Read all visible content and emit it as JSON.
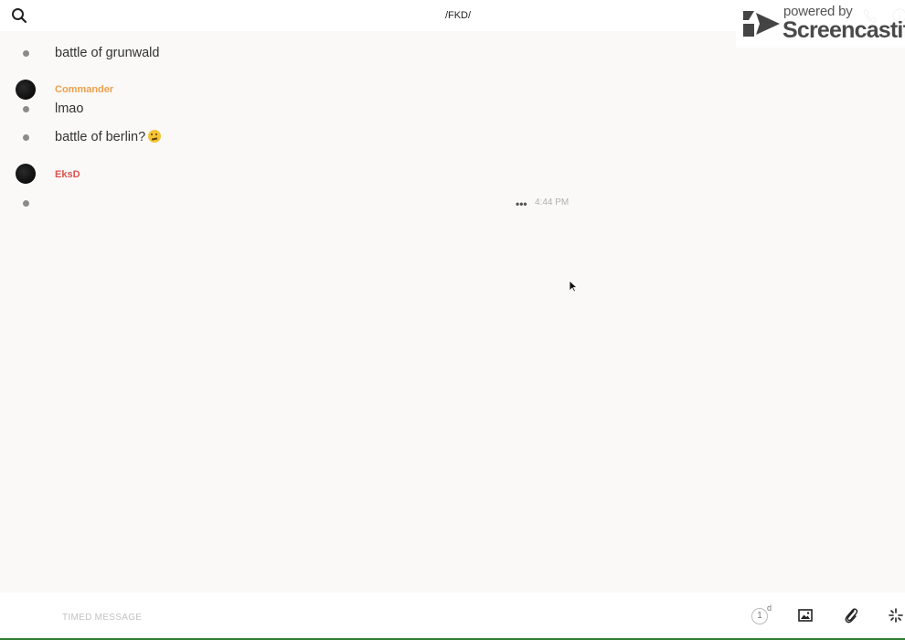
{
  "header": {
    "title": "/FKD/",
    "search_icon": "search-icon",
    "call_icon": "phone-icon",
    "info_icon": "info-icon"
  },
  "watermark": {
    "line1": "powered by",
    "line2": "Screencastify"
  },
  "messages": [
    {
      "type": "text",
      "text": "battle of grunwald"
    },
    {
      "type": "author",
      "name": "Commander",
      "color": "#f0a04b"
    },
    {
      "type": "text",
      "text": "lmao"
    },
    {
      "type": "text",
      "text": "battle of berlin?",
      "emoji": "thinking-face"
    },
    {
      "type": "author",
      "name": "EksD",
      "color": "#d9534f"
    },
    {
      "type": "pending",
      "more": "•••",
      "time": "4:44 PM"
    }
  ],
  "composer": {
    "placeholder": "TIMED MESSAGE",
    "timer_value": "1",
    "timer_unit": "d",
    "accent": "#2e7d32"
  }
}
